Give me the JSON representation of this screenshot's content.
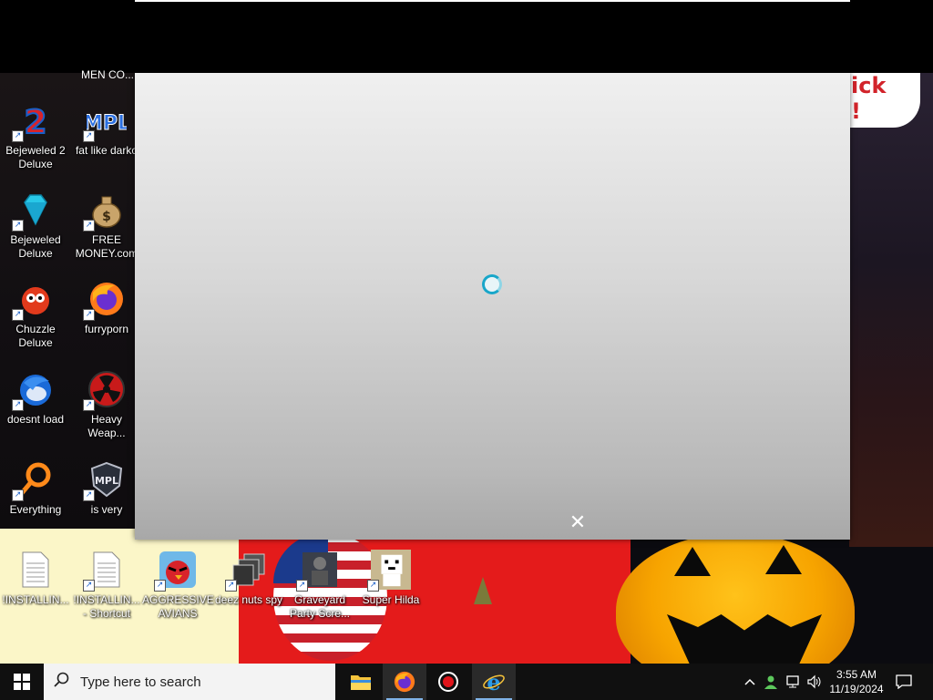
{
  "desktop": {
    "speech_text": "ick\n!",
    "top_cut_label": "MEN CO...",
    "icons": [
      {
        "label": "Bejeweled 2\nDeluxe",
        "icon": "bejeweled2-icon"
      },
      {
        "label": "fat like darko",
        "icon": "mpl-icon"
      },
      {
        "label": "Bejeweled\nDeluxe",
        "icon": "diamond-icon"
      },
      {
        "label": "FREE\nMONEY.com",
        "icon": "money-bag-icon"
      },
      {
        "label": "Chuzzle\nDeluxe",
        "icon": "chuzzle-icon"
      },
      {
        "label": "furryporn",
        "icon": "firefox-icon"
      },
      {
        "label": "doesnt load",
        "icon": "thunderbird-icon"
      },
      {
        "label": "Heavy\nWeap...",
        "icon": "radiation-icon"
      },
      {
        "label": "Everything",
        "icon": "search-magnifier-icon"
      },
      {
        "label": "is very",
        "icon": "mpl-shield-icon"
      },
      {
        "label": "!INSTALLIN...",
        "icon": "text-file-icon"
      },
      {
        "label": "!INSTALLIN...\n- Shortcut",
        "icon": "text-file-icon"
      },
      {
        "label": "AGGRESSIVE\nAVIANS",
        "icon": "angry-bird-icon"
      },
      {
        "label": "deez nuts spy",
        "icon": "windows-stack-icon"
      },
      {
        "label": "Graveyard\nParty Scre...",
        "icon": "graveyard-icon"
      },
      {
        "label": "Super Hilda",
        "icon": "pixel-dog-icon"
      }
    ]
  },
  "dialog": {
    "close_glyph": "✕"
  },
  "taskbar": {
    "search_placeholder": "Type here to search",
    "apps": [
      "file-explorer-icon",
      "firefox-icon",
      "record-icon",
      "internet-explorer-icon"
    ],
    "clock_time": "3:55 AM",
    "clock_date": "11/19/2024"
  },
  "colors": {
    "taskbar": "#101010",
    "search_box": "#f3f3f3",
    "spinner": "#18a6c9"
  }
}
